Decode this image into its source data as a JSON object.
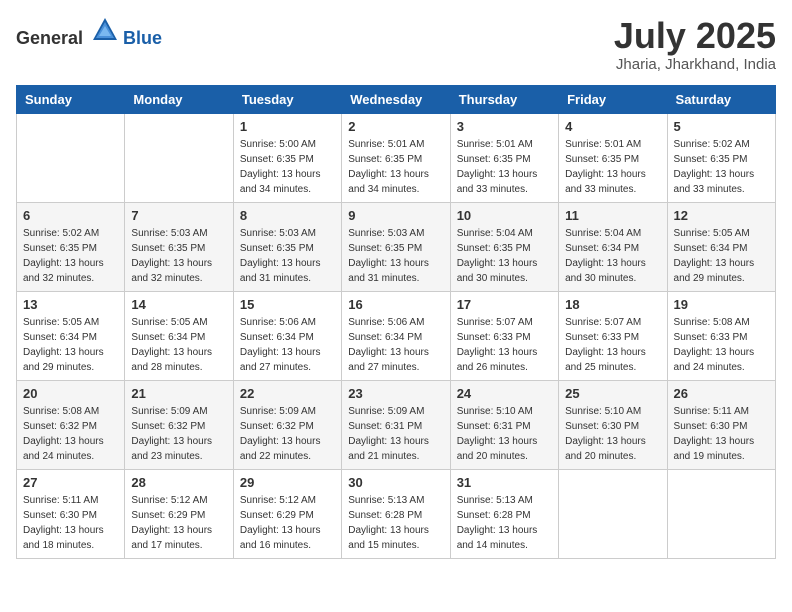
{
  "header": {
    "logo_general": "General",
    "logo_blue": "Blue",
    "month": "July 2025",
    "location": "Jharia, Jharkhand, India"
  },
  "weekdays": [
    "Sunday",
    "Monday",
    "Tuesday",
    "Wednesday",
    "Thursday",
    "Friday",
    "Saturday"
  ],
  "weeks": [
    [
      {
        "day": "",
        "info": ""
      },
      {
        "day": "",
        "info": ""
      },
      {
        "day": "1",
        "info": "Sunrise: 5:00 AM\nSunset: 6:35 PM\nDaylight: 13 hours and 34 minutes."
      },
      {
        "day": "2",
        "info": "Sunrise: 5:01 AM\nSunset: 6:35 PM\nDaylight: 13 hours and 34 minutes."
      },
      {
        "day": "3",
        "info": "Sunrise: 5:01 AM\nSunset: 6:35 PM\nDaylight: 13 hours and 33 minutes."
      },
      {
        "day": "4",
        "info": "Sunrise: 5:01 AM\nSunset: 6:35 PM\nDaylight: 13 hours and 33 minutes."
      },
      {
        "day": "5",
        "info": "Sunrise: 5:02 AM\nSunset: 6:35 PM\nDaylight: 13 hours and 33 minutes."
      }
    ],
    [
      {
        "day": "6",
        "info": "Sunrise: 5:02 AM\nSunset: 6:35 PM\nDaylight: 13 hours and 32 minutes."
      },
      {
        "day": "7",
        "info": "Sunrise: 5:03 AM\nSunset: 6:35 PM\nDaylight: 13 hours and 32 minutes."
      },
      {
        "day": "8",
        "info": "Sunrise: 5:03 AM\nSunset: 6:35 PM\nDaylight: 13 hours and 31 minutes."
      },
      {
        "day": "9",
        "info": "Sunrise: 5:03 AM\nSunset: 6:35 PM\nDaylight: 13 hours and 31 minutes."
      },
      {
        "day": "10",
        "info": "Sunrise: 5:04 AM\nSunset: 6:35 PM\nDaylight: 13 hours and 30 minutes."
      },
      {
        "day": "11",
        "info": "Sunrise: 5:04 AM\nSunset: 6:34 PM\nDaylight: 13 hours and 30 minutes."
      },
      {
        "day": "12",
        "info": "Sunrise: 5:05 AM\nSunset: 6:34 PM\nDaylight: 13 hours and 29 minutes."
      }
    ],
    [
      {
        "day": "13",
        "info": "Sunrise: 5:05 AM\nSunset: 6:34 PM\nDaylight: 13 hours and 29 minutes."
      },
      {
        "day": "14",
        "info": "Sunrise: 5:05 AM\nSunset: 6:34 PM\nDaylight: 13 hours and 28 minutes."
      },
      {
        "day": "15",
        "info": "Sunrise: 5:06 AM\nSunset: 6:34 PM\nDaylight: 13 hours and 27 minutes."
      },
      {
        "day": "16",
        "info": "Sunrise: 5:06 AM\nSunset: 6:34 PM\nDaylight: 13 hours and 27 minutes."
      },
      {
        "day": "17",
        "info": "Sunrise: 5:07 AM\nSunset: 6:33 PM\nDaylight: 13 hours and 26 minutes."
      },
      {
        "day": "18",
        "info": "Sunrise: 5:07 AM\nSunset: 6:33 PM\nDaylight: 13 hours and 25 minutes."
      },
      {
        "day": "19",
        "info": "Sunrise: 5:08 AM\nSunset: 6:33 PM\nDaylight: 13 hours and 24 minutes."
      }
    ],
    [
      {
        "day": "20",
        "info": "Sunrise: 5:08 AM\nSunset: 6:32 PM\nDaylight: 13 hours and 24 minutes."
      },
      {
        "day": "21",
        "info": "Sunrise: 5:09 AM\nSunset: 6:32 PM\nDaylight: 13 hours and 23 minutes."
      },
      {
        "day": "22",
        "info": "Sunrise: 5:09 AM\nSunset: 6:32 PM\nDaylight: 13 hours and 22 minutes."
      },
      {
        "day": "23",
        "info": "Sunrise: 5:09 AM\nSunset: 6:31 PM\nDaylight: 13 hours and 21 minutes."
      },
      {
        "day": "24",
        "info": "Sunrise: 5:10 AM\nSunset: 6:31 PM\nDaylight: 13 hours and 20 minutes."
      },
      {
        "day": "25",
        "info": "Sunrise: 5:10 AM\nSunset: 6:30 PM\nDaylight: 13 hours and 20 minutes."
      },
      {
        "day": "26",
        "info": "Sunrise: 5:11 AM\nSunset: 6:30 PM\nDaylight: 13 hours and 19 minutes."
      }
    ],
    [
      {
        "day": "27",
        "info": "Sunrise: 5:11 AM\nSunset: 6:30 PM\nDaylight: 13 hours and 18 minutes."
      },
      {
        "day": "28",
        "info": "Sunrise: 5:12 AM\nSunset: 6:29 PM\nDaylight: 13 hours and 17 minutes."
      },
      {
        "day": "29",
        "info": "Sunrise: 5:12 AM\nSunset: 6:29 PM\nDaylight: 13 hours and 16 minutes."
      },
      {
        "day": "30",
        "info": "Sunrise: 5:13 AM\nSunset: 6:28 PM\nDaylight: 13 hours and 15 minutes."
      },
      {
        "day": "31",
        "info": "Sunrise: 5:13 AM\nSunset: 6:28 PM\nDaylight: 13 hours and 14 minutes."
      },
      {
        "day": "",
        "info": ""
      },
      {
        "day": "",
        "info": ""
      }
    ]
  ]
}
